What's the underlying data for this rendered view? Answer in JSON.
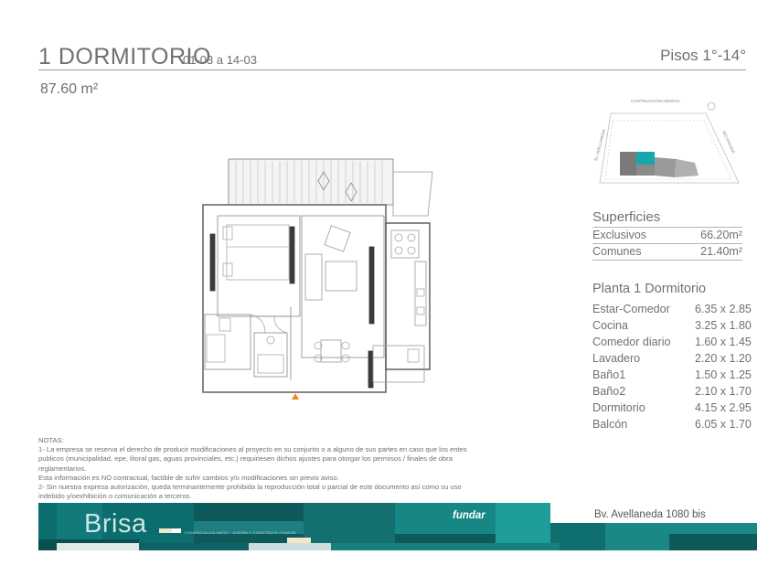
{
  "header": {
    "title": "1 DORMITORIO",
    "units": "01-03 a 14-03",
    "floors": "Pisos 1°-14°",
    "total_area": "87.60 m²"
  },
  "key_plan": {
    "street_top": "CONTINUACIÓN GÉNOVA",
    "street_left": "Bv. AVELLANEDA",
    "street_right": "RIO PARANÁ",
    "highlight_color": "#1aa7a9"
  },
  "superficies": {
    "title": "Superficies",
    "rows": [
      {
        "label": "Exclusivos",
        "value": "66.20m²"
      },
      {
        "label": "Comunes",
        "value": "21.40m²"
      }
    ]
  },
  "planta": {
    "title": "Planta 1 Dormitorio",
    "rooms": [
      {
        "label": "Estar-Comedor",
        "value": "6.35 x 2.85"
      },
      {
        "label": "Cocina",
        "value": "3.25 x 1.80"
      },
      {
        "label": "Comedor diario",
        "value": "1.60 x 1.45"
      },
      {
        "label": "Lavadero",
        "value": "2.20 x 1.20"
      },
      {
        "label": "Baño1",
        "value": "1.50 x 1.25"
      },
      {
        "label": "Baño2",
        "value": "2.10 x 1.70"
      },
      {
        "label": "Dormitorio",
        "value": "4.15 x 2.95"
      },
      {
        "label": "Balcón",
        "value": "6.05 x 1.70"
      }
    ]
  },
  "notes": {
    "heading": "NOTAS:",
    "lines": [
      "1- La empresa se reserva el derecho de producir modificaciones al proyecto en su conjunto o a alguno de sus partes en caso que los entes",
      "publicos (municipalidad, epe, litoral gas, aguas provinciales, etc.) requiriesen dichos ajustes para otorgar los permisos / finales de obra",
      "reglamentarios.",
      "Esta información es NO contractual, factible de sufrir cambios y/o modificaciones sin previo aviso.",
      "2- Sin nuestra expresa autorización, queda terminantemente prohibida la reproducción total o parcial de este documento así como su uso",
      "indebido y/oexhibición o comunicación a terceros."
    ]
  },
  "footer": {
    "brand": "Brisa",
    "tagline": "COMERCIALIZA IANTO · DISEÑA Y CONSTRUYE FUNDAR",
    "developer": "fundar",
    "address": "Bv. Avellaneda 1080 bis",
    "colors": {
      "dark": "#0e5a5b",
      "mid": "#16807f",
      "light": "#1f9d9a",
      "accent": "#f2e7c9"
    }
  }
}
